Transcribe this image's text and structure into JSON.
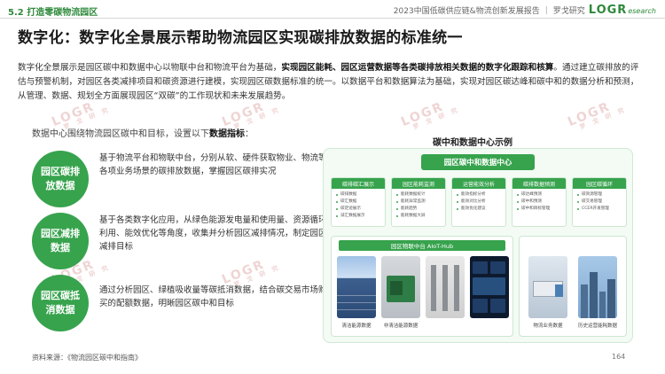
{
  "header": {
    "section": "5.2 打造零碳物流园区",
    "report_title": "2023中国低碳供应链&物流创新发展报告",
    "brand": "罗戈研究",
    "logo_main": "LOGR",
    "logo_sub": "esearch"
  },
  "headline": "数字化：数字化全景展示帮助物流园区实现碳排放数据的标准统一",
  "intro": {
    "p1": "数字化全景展示是园区碳中和数据中心以物联中台和物流平台为基础，",
    "p1_bold": "实现园区能耗、园区运营数据等各类碳排放相关数据的数字化跟踪和核算",
    "p2": "。通过建立碳排放的评估与预警机制，对园区各类减排项目和碳资源进行建模，实现园区碳数据标准的统一。以数据平台和数据算法为基础，实现对园区碳达峰和碳中和的数据分析和预测，从管理、数据、规划全方面展现园区“双碳”的工作现状和未来发展趋势。"
  },
  "watermark": {
    "mark": "LOGR",
    "chars": "罗 戈 研 究"
  },
  "indicators": {
    "lead": "数据中心围绕物流园区碳中和目标，设置以下",
    "lead_bold": "数据指标",
    "lead_end": "：",
    "items": [
      {
        "label": "园区碳排放数据",
        "text": "基于物流平台和物联中台，分别从软、硬件获取物业、物流等各项业务场景的碳排放数据，掌握园区碳排实况"
      },
      {
        "label": "园区减排数据",
        "text": "基于各类数字化应用，从绿色能源发电量和使用量、资源循环利用、能效优化等角度，收集并分析园区减排情况，制定园区减排目标"
      },
      {
        "label": "园区碳抵消数据",
        "text": "通过分析园区、绿植吸收量等碳抵消数据，结合碳交易市场购买的配额数据，明晰园区碳中和目标"
      }
    ]
  },
  "diagram": {
    "title": "碳中和数据中心示例",
    "center": "园区碳中和数据中心",
    "panels": [
      {
        "title": "碳排碳汇展示",
        "items": [
          "碳排数据",
          "碳汇数据",
          "碳足迹展示",
          "减汇数据展示"
        ]
      },
      {
        "title": "园区能耗监测",
        "items": [
          "能耗数据统计",
          "能耗异常监测",
          "能耗趋势",
          "能耗数据大屏"
        ]
      },
      {
        "title": "运营能效分析",
        "items": [
          "能效指标分析",
          "能效对比分析",
          "能效优化建议"
        ]
      },
      {
        "title": "碳排数据预测",
        "items": [
          "碳达峰预测",
          "碳中和预测",
          "碳中和目标管理"
        ]
      },
      {
        "title": "园区碳循环",
        "items": [
          "碳资源管理",
          "碳交易管理",
          "CCER开发管理"
        ]
      }
    ],
    "hub": {
      "title": "园区物联中台 AIoT-Hub",
      "tiles": [
        "清洁能源数据",
        "非清洁能源数据",
        "",
        ""
      ]
    },
    "side_tiles": [
      "物流业务数据",
      "历史运营能耗数据"
    ]
  },
  "footer": {
    "source": "资料来源：《物流园区碳中和指南》",
    "page": "164"
  },
  "colors": {
    "accent": "#37a34d",
    "brand": "#2e8a3b"
  }
}
